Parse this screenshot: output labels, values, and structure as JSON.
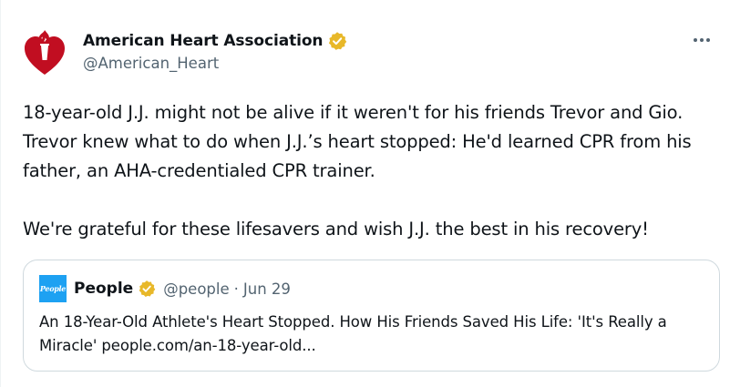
{
  "author": {
    "display_name": "American Heart Association",
    "handle": "@American_Heart",
    "verified_color": "#e8b829"
  },
  "tweet": {
    "paragraph1": "18-year-old J.J. might not be alive if it weren't for his friends Trevor and Gio. Trevor knew what to do when J.J.’s heart stopped: He'd learned CPR from his father, an AHA-credentialed CPR trainer.",
    "paragraph2": "We're grateful for these lifesavers and wish J.J. the best in his recovery!"
  },
  "quoted": {
    "avatar_text": "People",
    "display_name": "People",
    "handle": "@people",
    "separator": "·",
    "date": "Jun 29",
    "text": "An 18-Year-Old Athlete's Heart Stopped. How His Friends Saved His Life: 'It's Really a Miracle' people.com/an-18-year-old..."
  },
  "icons": {
    "avatar": "aha-heart-torch-logo",
    "more": "more-dots-icon",
    "verified": "verified-badge-icon"
  },
  "colors": {
    "brand_red": "#c10e21",
    "people_blue": "#1da1f2",
    "secondary_text": "#536471"
  }
}
